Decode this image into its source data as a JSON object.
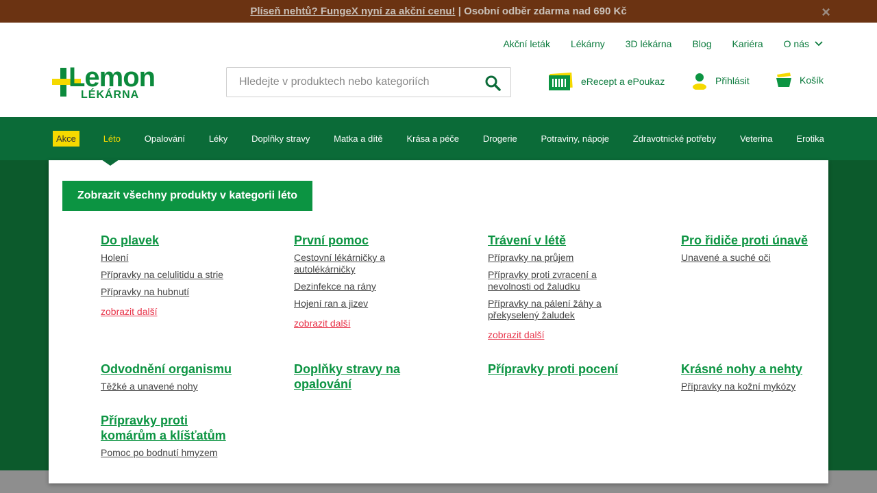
{
  "promo": {
    "link_text": "Plíseň nehtů? FungeX nyní za akční cenu!",
    "separator": " | ",
    "rest": "Osobní odběr zdarma nad 690 Kč",
    "close": "×"
  },
  "util_nav": [
    "Akční leták",
    "Lékárny",
    "3D lékárna",
    "Blog",
    "Kariéra",
    "O nás"
  ],
  "logo": {
    "word": "Lemon",
    "sub": "LÉKÁRNA"
  },
  "search": {
    "placeholder": "Hledejte v produktech nebo kategoriích"
  },
  "actions": {
    "erecept": "eRecept a ePoukaz",
    "login": "Přihlásit",
    "cart": "Košík"
  },
  "main_nav": [
    "Akce",
    "Léto",
    "Opalování",
    "Léky",
    "Doplňky stravy",
    "Matka a dítě",
    "Krása a péče",
    "Drogerie",
    "Potraviny, nápoje",
    "Zdravotnické potřeby",
    "Veterina",
    "Erotika"
  ],
  "menu": {
    "show_all": "Zobrazit všechny produkty v kategorii léto",
    "categories": [
      {
        "title": "Do plavek",
        "items": [
          "Holení",
          "Přípravky na celulitidu a strie",
          "Přípravky na hubnutí"
        ],
        "more": "zobrazit další"
      },
      {
        "title": "První pomoc",
        "items": [
          "Cestovní lékárničky a autolékárničky",
          "Dezinfekce na rány",
          "Hojení ran a jizev"
        ],
        "more": "zobrazit další"
      },
      {
        "title": "Trávení v létě",
        "items": [
          "Přípravky na průjem",
          "Přípravky proti zvracení a nevolnosti od žaludku",
          "Přípravky na pálení žáhy a překyselený žaludek"
        ],
        "more": "zobrazit další"
      },
      {
        "title": "Pro řidiče proti únavě",
        "items": [
          "Unavené a suché oči"
        ]
      },
      {
        "title": "Odvodnění organismu",
        "items": [
          "Těžké a unavené nohy"
        ]
      },
      {
        "title": "Doplňky stravy na opalování",
        "items": []
      },
      {
        "title": "Přípravky proti pocení",
        "items": []
      },
      {
        "title": "Krásné nohy a nehty",
        "items": [
          "Přípravky na kožní mykózy"
        ]
      },
      {
        "title": "Přípravky proti komárům a klíšťatům",
        "items": [
          "Pomoc po bodnutí hmyzem"
        ]
      }
    ]
  },
  "colors": {
    "brand_green": "#0c9442",
    "nav_green": "#0b6b38",
    "accent_yellow": "#f5d900",
    "promo_bg": "#6b3312",
    "more_red": "#e8344a"
  }
}
